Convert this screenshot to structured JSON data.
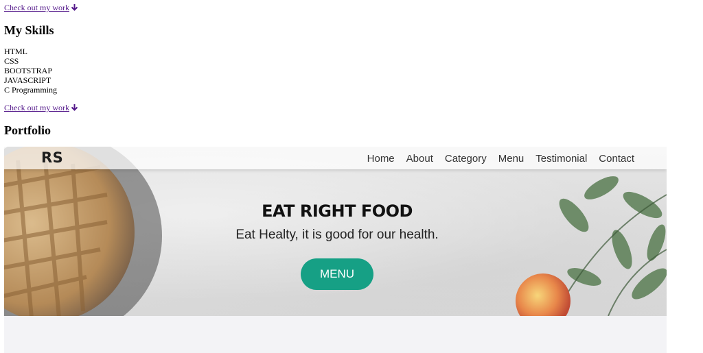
{
  "links": {
    "check_work_1": "Check out my work",
    "check_work_2": "Check out my work"
  },
  "skills": {
    "heading": "My Skills",
    "items": [
      "HTML",
      "CSS",
      "BOOTSTRAP",
      "JAVASCRIPT",
      "C Programming"
    ]
  },
  "portfolio": {
    "heading": "Portfolio",
    "preview": {
      "logo": "RS",
      "nav": [
        "Home",
        "About",
        "Category",
        "Menu",
        "Testimonial",
        "Contact"
      ],
      "hero_title": "EAT RIGHT FOOD",
      "hero_subtitle": "Eat Healty, it is good for our health.",
      "cta_label": "MENU"
    }
  },
  "colors": {
    "link": "#551a8b",
    "accent": "#16a085",
    "frame_bg": "#f3f3f6"
  },
  "icons": [
    "arrow-down-icon"
  ]
}
